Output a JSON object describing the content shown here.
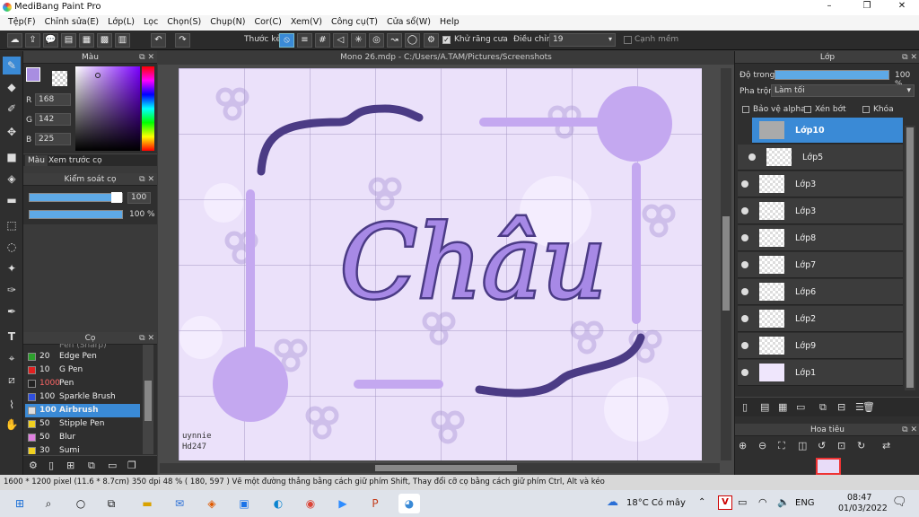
{
  "window": {
    "title": "MediBang Paint Pro",
    "minimize": "–",
    "maximize": "❐",
    "close": "✕"
  },
  "menu": [
    "Tệp(F)",
    "Chỉnh sửa(E)",
    "Lớp(L)",
    "Lọc",
    "Chọn(S)",
    "Chụp(N)",
    "Cor(C)",
    "Xem(V)",
    "Công cụ(T)",
    "Cửa sổ(W)",
    "Help"
  ],
  "toolbar": {
    "ruler_label": "Thước kẻ",
    "antialias_label": "Khử răng cưa",
    "adjust_label": "Điều chỉnh",
    "adjust_value": "19",
    "edge_label": "Cạnh mềm"
  },
  "color_panel": {
    "title": "Màu",
    "r_label": "R",
    "r": "168",
    "g_label": "G",
    "g": "142",
    "b_label": "B",
    "b": "225",
    "tab_color": "Màu",
    "tab_preview": "Xem trước cọ",
    "fg": "#a88ee1"
  },
  "brush_control": {
    "title": "Kiểm soát cọ",
    "size": "100",
    "opacity": "100 %"
  },
  "brush_panel": {
    "title": "Cọ",
    "items": [
      {
        "size": "20",
        "name": "Edge Pen",
        "color": "#2ca02c"
      },
      {
        "size": "10",
        "name": "G Pen",
        "color": "#e02020"
      },
      {
        "size": "1000",
        "name": "Pen",
        "color": "#222222"
      },
      {
        "size": "100",
        "name": "Sparkle Brush",
        "color": "#3050e0"
      },
      {
        "size": "100",
        "name": "Airbrush",
        "color": "#dddddd"
      },
      {
        "size": "50",
        "name": "Stipple Pen",
        "color": "#f0d020"
      },
      {
        "size": "50",
        "name": "Blur",
        "color": "#e080e0"
      },
      {
        "size": "30",
        "name": "Sumi",
        "color": "#f0d020"
      }
    ],
    "partial_top": "Pen (Sharp)"
  },
  "document": {
    "tab": "Mono 26.mdp - C:/Users/A.TAM/Pictures/Screenshots",
    "artwork_text": "Châu",
    "signature": "uynnie\nHd247"
  },
  "layers_panel": {
    "title": "Lớp",
    "opacity_label": "Độ trong",
    "opacity_value": "100 %",
    "blend_label": "Pha trộn",
    "blend_value": "Làm tối",
    "protect_alpha": "Bảo vệ alpha",
    "clip": "Xén bớt",
    "lock": "Khóa",
    "layers": [
      "Lớp10",
      "Lớp5",
      "Lớp3",
      "Lớp3",
      "Lớp8",
      "Lớp7",
      "Lớp6",
      "Lớp2",
      "Lớp9",
      "Lớp1"
    ]
  },
  "navigator": {
    "title": "Hoa tiêu"
  },
  "status": {
    "text": "1600 * 1200 pixel   (11.6 * 8.7cm)   350 dpi   48 %   ( 180, 597 )   Vẽ một đường thẳng bằng cách giữ phím Shift, Thay đổi cỡ cọ bằng cách giữ phím Ctrl, Alt và kéo"
  },
  "taskbar": {
    "weather": "18°C  Có mây",
    "lang": "ENG",
    "time": "08:47",
    "date": "01/03/2022"
  }
}
